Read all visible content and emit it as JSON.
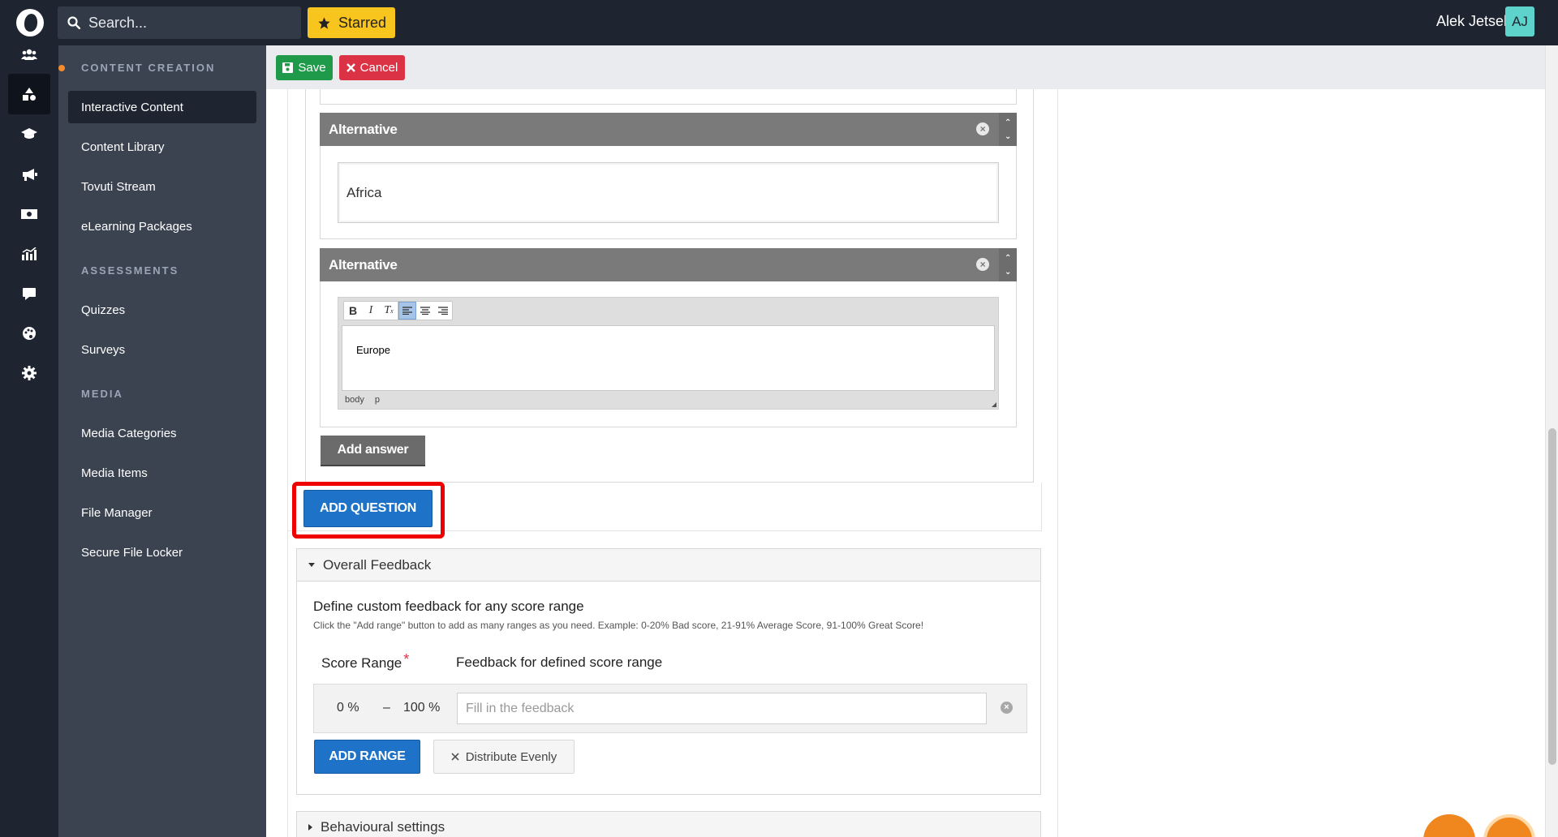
{
  "topbar": {
    "search_placeholder": "Search...",
    "starred_label": "Starred",
    "user_name": "Alek Jetsel",
    "user_initials": "AJ"
  },
  "rail": {
    "icons": [
      "users-icon",
      "content-shapes-icon",
      "graduation-cap-icon",
      "megaphone-icon",
      "money-icon",
      "analytics-icon",
      "chat-icon",
      "palette-icon",
      "gear-icon"
    ],
    "active_index": 1
  },
  "nav": {
    "sections": [
      {
        "title": "CONTENT CREATION",
        "items": [
          "Interactive Content",
          "Content Library",
          "Tovuti Stream",
          "eLearning Packages"
        ]
      },
      {
        "title": "ASSESSMENTS",
        "items": [
          "Quizzes",
          "Surveys"
        ]
      },
      {
        "title": "MEDIA",
        "items": [
          "Media Categories",
          "Media Items",
          "File Manager",
          "Secure File Locker"
        ]
      }
    ],
    "active_item": "Interactive Content"
  },
  "actions": {
    "save_label": "Save",
    "cancel_label": "Cancel"
  },
  "question": {
    "alternatives": [
      {
        "header": "Alternative",
        "value": "Africa"
      },
      {
        "header": "Alternative",
        "value": "Europe"
      }
    ],
    "rte_status": [
      "body",
      "p"
    ],
    "add_answer_label": "Add answer",
    "add_question_label": "ADD QUESTION"
  },
  "overall_feedback": {
    "header": "Overall Feedback",
    "title": "Define custom feedback for any score range",
    "description": "Click the \"Add range\" button to add as many ranges as you need. Example: 0-20% Bad score, 21-91% Average Score, 91-100% Great Score!",
    "col_score_range": "Score Range",
    "col_feedback": "Feedback for defined score range",
    "range": {
      "min": "0 %",
      "dash": "–",
      "max": "100 %",
      "placeholder": "Fill in the feedback"
    },
    "add_range_label": "ADD RANGE",
    "distribute_label": "Distribute Evenly"
  },
  "behavioural": {
    "header": "Behavioural settings"
  },
  "colors": {
    "topbar": "#1e2531",
    "nav": "#3b4351",
    "starred": "#f7c51e",
    "save": "#1f9a4a",
    "cancel": "#dc3246",
    "primary_button": "#1e73c8",
    "highlight": "#ee0000",
    "avatar": "#5dd3cc",
    "floating": "#f0861e"
  }
}
